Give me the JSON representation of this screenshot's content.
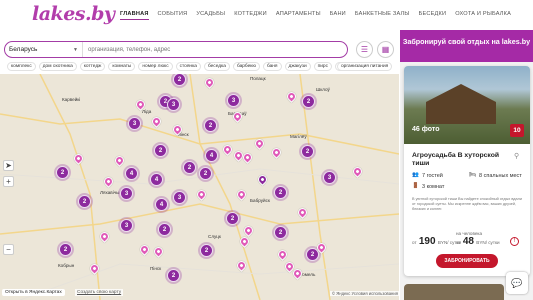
{
  "logo": "lakes.by",
  "nav": [
    "Главная",
    "События",
    "Усадьбы",
    "Коттеджи",
    "Апартаменты",
    "Бани",
    "Банкетные залы",
    "Беседки",
    "Охота и рыбалка"
  ],
  "search": {
    "region": "Беларусь",
    "placeholder": "организация, телефон, адрес"
  },
  "chips": [
    "комплекс",
    "дом охотника",
    "коттедж",
    "комнаты",
    "номер люкс",
    "стоянка",
    "беседка",
    "барбекю",
    "баня",
    "джакузи",
    "пирс",
    "банкетный зал"
  ],
  "chip_right": "организация питания",
  "map": {
    "cities": [
      "Карвейкі",
      "Ляхавічы",
      "Кобрын",
      "Мінск",
      "Ліда",
      "Барысаў",
      "Магілёў",
      "Бабруйск",
      "Гомель",
      "Пінск",
      "Шклоў",
      "Слуцк",
      "Полацк"
    ],
    "clusters": [
      "2",
      "2",
      "3",
      "3",
      "2",
      "3",
      "2",
      "2",
      "4",
      "2",
      "2",
      "2",
      "4",
      "4",
      "2",
      "3",
      "2",
      "3",
      "3",
      "2",
      "4",
      "2",
      "3",
      "2",
      "2",
      "2",
      "2",
      "2",
      "2"
    ],
    "open_link": "Открыть в Яндекс.Картах",
    "bug_link": "Создать свою карту",
    "copyright": "© Яндекс Условия использования"
  },
  "promo": "Забронируй свой отдых на lakes.by",
  "card": {
    "photos": "46 фото",
    "rating": "10",
    "title": "Агроусадьба В хуторской тиши",
    "guests": "7 гостей",
    "beds": "8 спальных мест",
    "rooms": "3 комнат",
    "description": "В уютной хуторской тиши Вы найдете спокойный отдых вдали от городской суеты. Мы искренне ждём вас, ваших друзей, близких и коллег.",
    "price_from": "от",
    "price1": "190",
    "price1_unit": "BYN/ сутки",
    "price_per": "на человека",
    "price2": "48",
    "price2_unit": "BYN/ сутки",
    "book": "ЗАБРОНИРОВАТЬ"
  },
  "colors": {
    "accent": "#a52aa6",
    "brand_red": "#c4172c",
    "cluster": "#8d2a9e"
  }
}
